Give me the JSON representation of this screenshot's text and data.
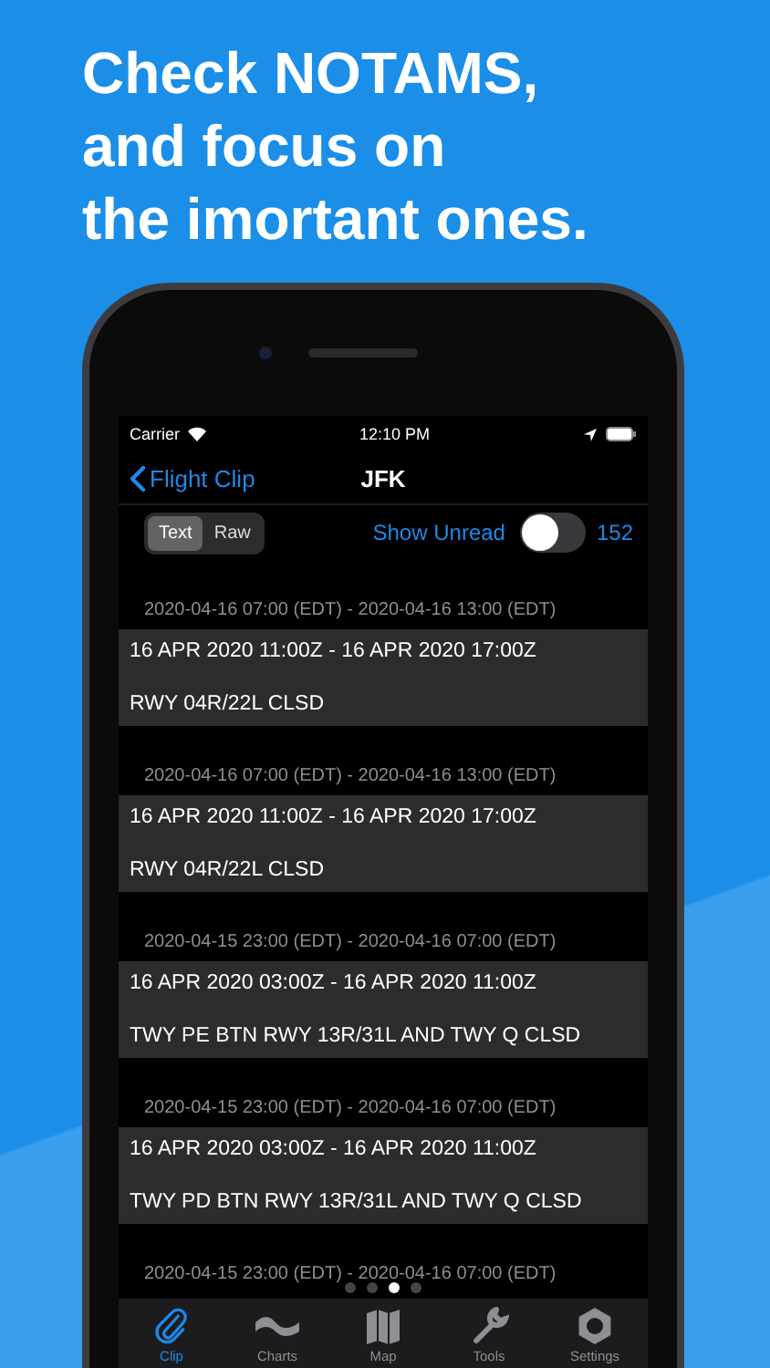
{
  "headline": [
    "Check NOTAMS,",
    "and focus on",
    "the imortant ones."
  ],
  "status_bar": {
    "carrier": "Carrier",
    "time": "12:10 PM"
  },
  "nav_bar": {
    "back": "Flight Clip",
    "title": "JFK"
  },
  "segments": [
    {
      "label": "Text",
      "selected": true
    },
    {
      "label": "Raw",
      "selected": false
    }
  ],
  "show_unread": {
    "label": "Show Unread",
    "on": false,
    "count": "152"
  },
  "notams": [
    {
      "local_period": "2020-04-16 07:00 (EDT) - 2020-04-16 13:00 (EDT)",
      "utc_period": "16 APR 2020 11:00Z - 16 APR 2020 17:00Z",
      "text": "RWY 04R/22L CLSD"
    },
    {
      "local_period": "2020-04-16 07:00 (EDT) - 2020-04-16 13:00 (EDT)",
      "utc_period": "16 APR 2020 11:00Z - 16 APR 2020 17:00Z",
      "text": "RWY 04R/22L CLSD"
    },
    {
      "local_period": "2020-04-15 23:00 (EDT) - 2020-04-16 07:00 (EDT)",
      "utc_period": "16 APR 2020 03:00Z - 16 APR 2020 11:00Z",
      "text": "TWY PE BTN RWY 13R/31L AND TWY Q CLSD"
    },
    {
      "local_period": "2020-04-15 23:00 (EDT) - 2020-04-16 07:00 (EDT)",
      "utc_period": "16 APR 2020 03:00Z - 16 APR 2020 11:00Z",
      "text": "TWY PD BTN RWY 13R/31L AND TWY Q CLSD"
    },
    {
      "local_period": "2020-04-15 23:00 (EDT) - 2020-04-16 07:00 (EDT)"
    }
  ],
  "page_dots": [
    {
      "selected": false
    },
    {
      "selected": false
    },
    {
      "selected": true
    },
    {
      "selected": false
    }
  ],
  "tabs": [
    {
      "kind": "clip",
      "label": "Clip",
      "selected": true
    },
    {
      "kind": "charts",
      "label": "Charts",
      "selected": false
    },
    {
      "kind": "map",
      "label": "Map",
      "selected": false
    },
    {
      "kind": "tools",
      "label": "Tools",
      "selected": false
    },
    {
      "kind": "settings",
      "label": "Settings",
      "selected": false
    }
  ]
}
